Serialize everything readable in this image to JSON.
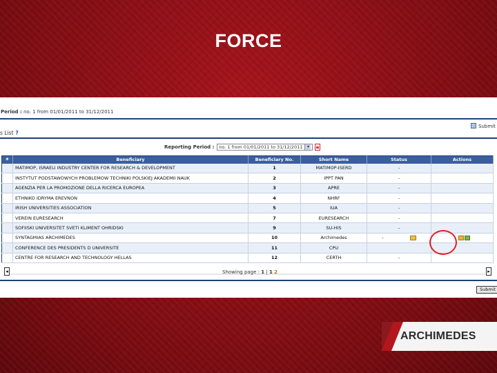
{
  "slide": {
    "title": "FORCE",
    "logo_text": "ARCHIMEDES"
  },
  "screen": {
    "period_label": "Period :",
    "period_value": "no. 1 from 01/01/2011 to 31/12/2011",
    "list_label": "s List",
    "help_mark": "?",
    "submit_top": "Submit",
    "reporting_period_label": "Reporting Period :",
    "reporting_period_value": "no. 1 from 01/01/2011 to 31/12/2011",
    "columns": [
      "Beneficiary",
      "Beneficiary No.",
      "Short Name",
      "Status",
      "Actions"
    ],
    "rows": [
      {
        "beneficiary": "MATIMOP, ISRAELI INDUSTRY CENTER FOR RESEARCH & DEVELOPMENT",
        "no": "1",
        "short": "MATIMOP-ISERD",
        "status": "-"
      },
      {
        "beneficiary": "INSTYTUT PODSTAWOWYCH PROBLEMOW TECHNIKI POLSKIEJ AKADEMII NAUK",
        "no": "2",
        "short": "IPPT PAN",
        "status": "-"
      },
      {
        "beneficiary": "AGENZIA PER LA PROMOZIONE DELLA RICERCA EUROPEA",
        "no": "3",
        "short": "APRE",
        "status": "-"
      },
      {
        "beneficiary": "ETHNIKO IDRYMA EREVNON",
        "no": "4",
        "short": "NHRF",
        "status": "-"
      },
      {
        "beneficiary": "IRISH UNIVERSITIES ASSOCIATION",
        "no": "5",
        "short": "IUA",
        "status": "-"
      },
      {
        "beneficiary": "VEREIN EURESEARCH",
        "no": "7",
        "short": "EURESEARCH",
        "status": "-"
      },
      {
        "beneficiary": "SOFIISKI UNIVERSITET SVETI KLIMENT OHRIDSKI",
        "no": "9",
        "short": "SU-HIS",
        "status": "-"
      },
      {
        "beneficiary": "SYNTAGMIAS ARCHIMEDES",
        "no": "10",
        "short": "Archimedes",
        "status": "-"
      },
      {
        "beneficiary": "CONFERENCE DES PRESIDENTS D UNIVERSITE",
        "no": "11",
        "short": "CPU",
        "status": ""
      },
      {
        "beneficiary": "CENTRE FOR RESEARCH AND TECHNOLOGY HELLAS",
        "no": "12",
        "short": "CERTH",
        "status": "-"
      }
    ],
    "paging_label": "Showing page :",
    "paging_current": "1",
    "paging_sep": "|",
    "paging_pages": [
      "1",
      "2"
    ],
    "submit_button": "Submit",
    "scroll_left": "◂",
    "scroll_right": "▸"
  },
  "icons": {
    "header_pin": "pin-icon",
    "edit": "edit-icon",
    "actions": [
      "document-icon",
      "approve-icon"
    ],
    "pdf": "pdf-icon"
  },
  "colors": {
    "background": "#8e1016",
    "header": "#3b5f9e",
    "highlight": "#e02020"
  }
}
